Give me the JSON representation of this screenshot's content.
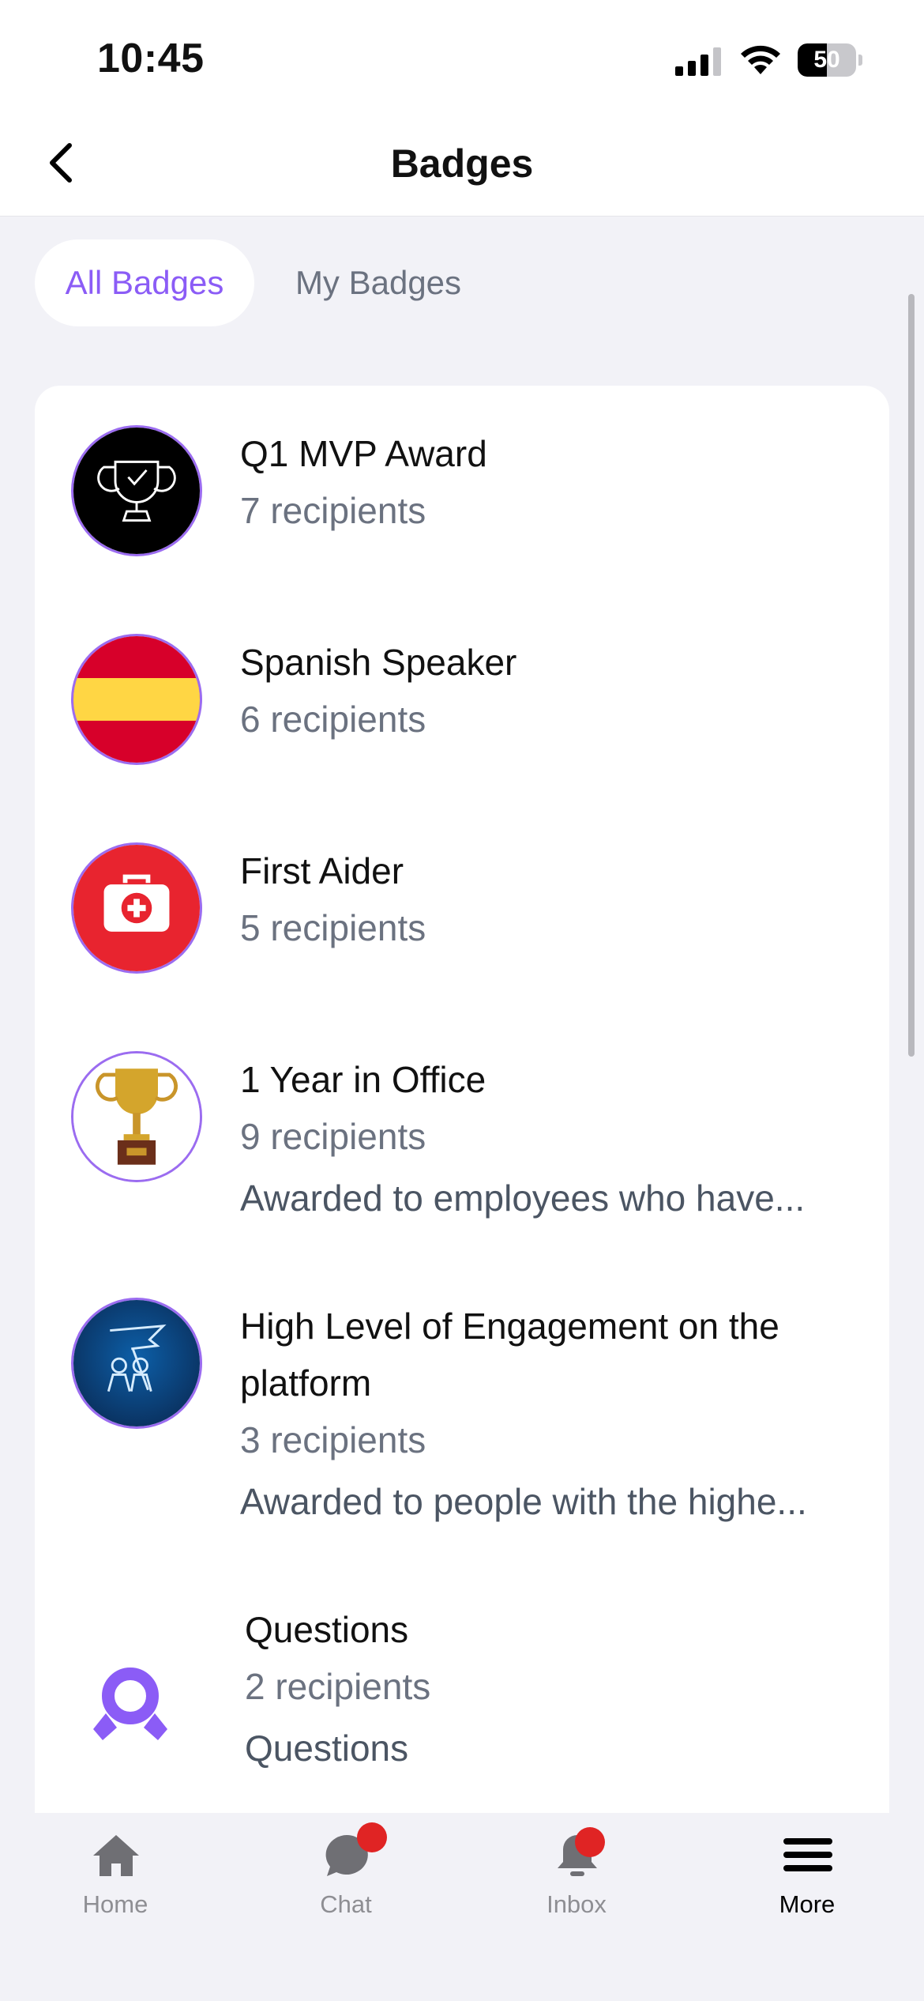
{
  "status_bar": {
    "time": "10:45",
    "battery_percent": "50"
  },
  "header": {
    "title": "Badges"
  },
  "tabs": [
    {
      "label": "All Badges",
      "active": true
    },
    {
      "label": "My Badges",
      "active": false
    }
  ],
  "badges": [
    {
      "name": "Q1 MVP Award",
      "recipients": "7 recipients",
      "description": "",
      "icon": "trophy-outline-icon"
    },
    {
      "name": "Spanish Speaker",
      "recipients": "6 recipients",
      "description": "",
      "icon": "spain-flag-icon"
    },
    {
      "name": "First Aider",
      "recipients": "5 recipients",
      "description": "",
      "icon": "first-aid-kit-icon"
    },
    {
      "name": "1 Year in Office",
      "recipients": "9 recipients",
      "description": "Awarded to employees who have...",
      "icon": "gold-trophy-icon"
    },
    {
      "name": "High Level of Engagement on the platform",
      "recipients": "3 recipients",
      "description": "Awarded to people with the highe...",
      "icon": "team-flag-icon"
    },
    {
      "name": "Questions",
      "recipients": "2 recipients",
      "description": "Questions",
      "icon": "award-ribbon-icon"
    }
  ],
  "bottom_nav": [
    {
      "label": "Home",
      "icon": "home-icon",
      "active": false,
      "notification": false
    },
    {
      "label": "Chat",
      "icon": "chat-bubble-icon",
      "active": false,
      "notification": true
    },
    {
      "label": "Inbox",
      "icon": "bell-icon",
      "active": false,
      "notification": true
    },
    {
      "label": "More",
      "icon": "hamburger-menu-icon",
      "active": true,
      "notification": false
    }
  ],
  "colors": {
    "accent": "#8b5cf6",
    "notification": "#e02424",
    "muted_text": "#6b7280"
  }
}
